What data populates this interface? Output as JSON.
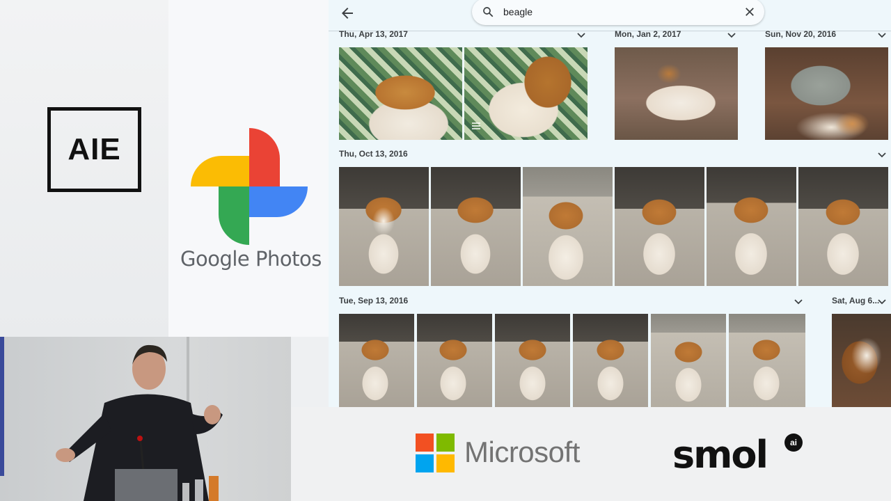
{
  "branding": {
    "aie_logo": "AIE",
    "google_photos_text": "Google Photos",
    "microsoft_text": "Microsoft",
    "smol_text": "smol",
    "smol_badge": "ai"
  },
  "search": {
    "query": "beagle",
    "back_icon": "arrow-left-icon",
    "search_icon": "search-icon",
    "clear_icon": "close-icon"
  },
  "groups": [
    {
      "date": "Thu, Apr 13, 2017"
    },
    {
      "date": "Mon, Jan 2, 2017"
    },
    {
      "date": "Sun, Nov 20, 2016"
    },
    {
      "date": "Thu, Oct 13, 2016"
    },
    {
      "date": "Tue, Sep 13, 2016"
    },
    {
      "date": "Sat, Aug 6..."
    }
  ],
  "colors": {
    "google_red": "#ea4335",
    "google_yellow": "#fbbc04",
    "google_green": "#34a853",
    "google_blue": "#4285f4"
  }
}
